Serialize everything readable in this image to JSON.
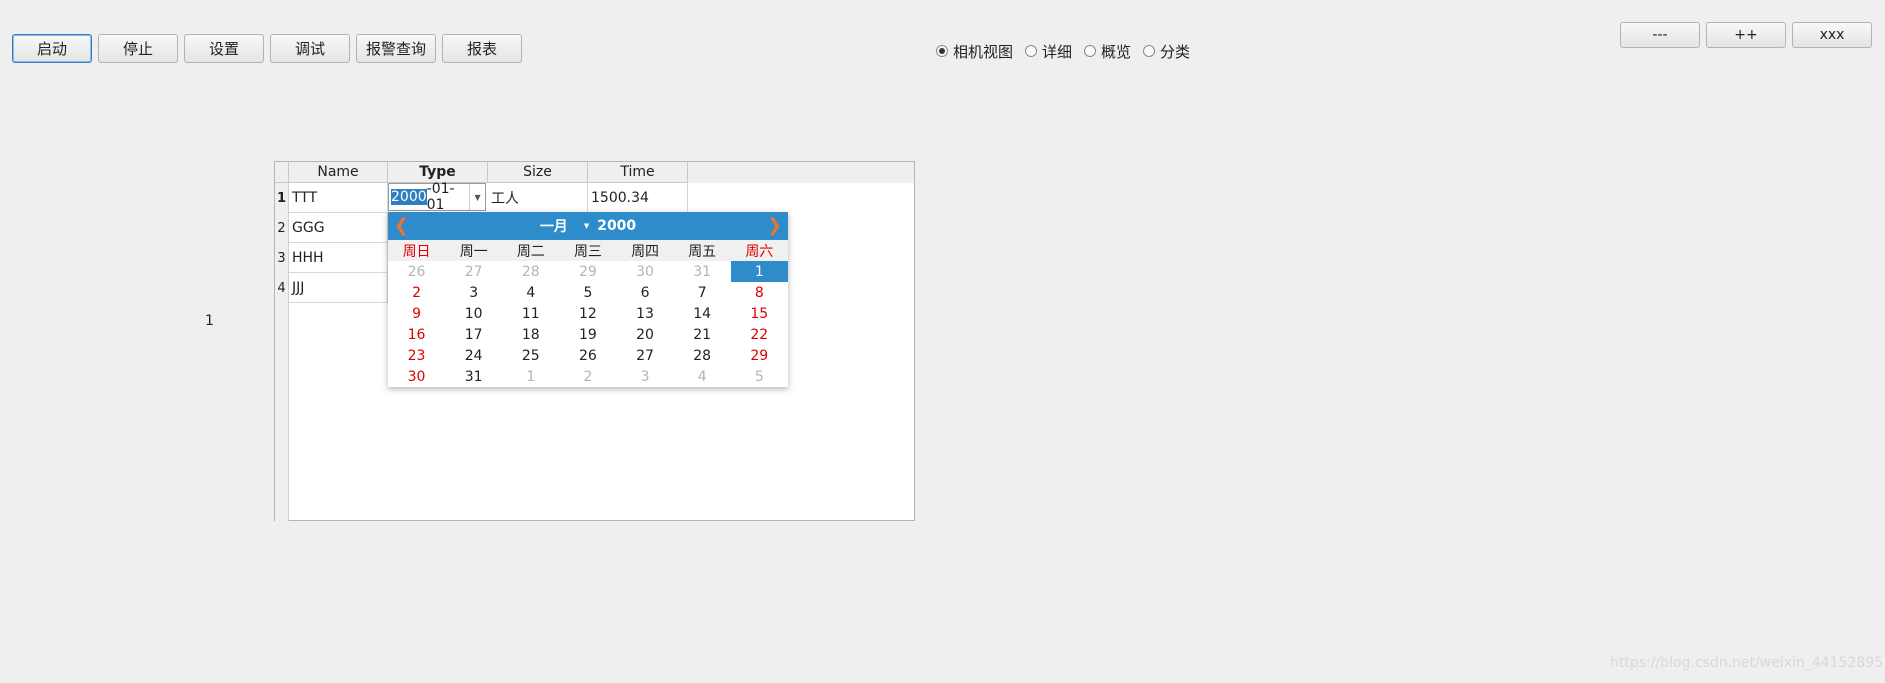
{
  "toolbar": {
    "buttons": [
      "启动",
      "停止",
      "设置",
      "调试",
      "报警查询",
      "报表"
    ]
  },
  "view_radios": {
    "options": [
      "相机视图",
      "详细",
      "概览",
      "分类"
    ],
    "selected": "相机视图"
  },
  "window_buttons": [
    "---",
    "++",
    "xxx"
  ],
  "table": {
    "headers": [
      "Name",
      "Type",
      "Size",
      "Time"
    ],
    "row_numbers": [
      "1",
      "2",
      "3",
      "4"
    ],
    "rows": [
      {
        "name": "TTT",
        "type": "2000-01-01",
        "size": "工人",
        "time": "1500.34"
      },
      {
        "name": "GGG"
      },
      {
        "name": "HHH"
      },
      {
        "name": "JJJ"
      }
    ]
  },
  "date_editor": {
    "selected_part": "2000",
    "rest": "-01-01"
  },
  "calendar": {
    "month": "一月",
    "year": "2000",
    "weekdays": [
      "周日",
      "周一",
      "周二",
      "周三",
      "周四",
      "周五",
      "周六"
    ],
    "weeks": [
      [
        "26",
        "27",
        "28",
        "29",
        "30",
        "31",
        "1"
      ],
      [
        "2",
        "3",
        "4",
        "5",
        "6",
        "7",
        "8"
      ],
      [
        "9",
        "10",
        "11",
        "12",
        "13",
        "14",
        "15"
      ],
      [
        "16",
        "17",
        "18",
        "19",
        "20",
        "21",
        "22"
      ],
      [
        "23",
        "24",
        "25",
        "26",
        "27",
        "28",
        "29"
      ],
      [
        "30",
        "31",
        "1",
        "2",
        "3",
        "4",
        "5"
      ]
    ],
    "selected_day": "1",
    "colors": {
      "header": "#2f8ccb",
      "weekend": "#e00000",
      "other_month": "#b4b4b4",
      "nav_arrow": "#f07030"
    }
  },
  "loose_label": "1",
  "watermark": "https://blog.csdn.net/weixin_44152895"
}
